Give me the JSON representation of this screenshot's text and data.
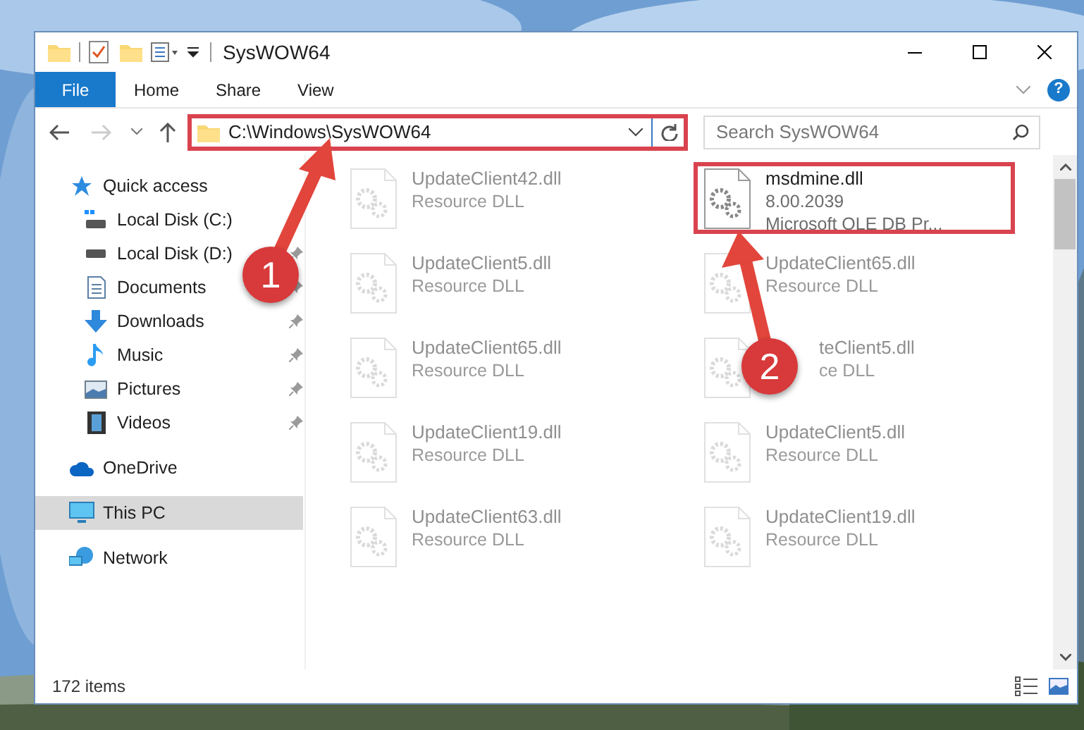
{
  "window": {
    "title": "SysWOW64"
  },
  "help_button": {
    "label": "?"
  },
  "ribbon_tabs": [
    {
      "label": "File",
      "selected": true
    },
    {
      "label": "Home",
      "selected": false
    },
    {
      "label": "Share",
      "selected": false
    },
    {
      "label": "View",
      "selected": false
    }
  ],
  "address": {
    "value": "C:\\Windows\\SysWOW64",
    "highlighted": true
  },
  "search": {
    "placeholder": "Search SysWOW64"
  },
  "sidebar": {
    "items": [
      {
        "label": "Quick access",
        "selected": false,
        "children": [
          {
            "label": "Local Disk (C:)",
            "selected": false,
            "pinned": false
          },
          {
            "label": "Local Disk (D:)",
            "selected": false,
            "pinned": true
          },
          {
            "label": "Documents",
            "selected": false,
            "pinned": true
          },
          {
            "label": "Downloads",
            "selected": false,
            "pinned": true
          },
          {
            "label": "Music",
            "selected": false,
            "pinned": true
          },
          {
            "label": "Pictures",
            "selected": false,
            "pinned": true
          },
          {
            "label": "Videos",
            "selected": false,
            "pinned": true
          }
        ]
      },
      {
        "label": "OneDrive",
        "selected": false
      },
      {
        "label": "This PC",
        "selected": true
      },
      {
        "label": "Network",
        "selected": false
      }
    ]
  },
  "files": [
    {
      "name": "UpdateClient42.dll",
      "details": [
        "Resource DLL"
      ],
      "highlighted": false
    },
    {
      "name": "msdmine.dll",
      "details": [
        "8.00.2039",
        "Microsoft OLE DB Pr..."
      ],
      "highlighted": true
    },
    {
      "name": "UpdateClient5.dll",
      "details": [
        "Resource DLL"
      ],
      "highlighted": false
    },
    {
      "name": "UpdateClient65.dll",
      "details": [
        "Resource DLL"
      ],
      "highlighted": false
    },
    {
      "name": "UpdateClient65.dll",
      "details": [
        "Resource DLL"
      ],
      "highlighted": false
    },
    {
      "name": "teClient5.dll",
      "details": [
        "ce DLL"
      ],
      "highlighted": false,
      "covered": true
    },
    {
      "name": "UpdateClient19.dll",
      "details": [
        "Resource DLL"
      ],
      "highlighted": false
    },
    {
      "name": "UpdateClient5.dll",
      "details": [
        "Resource DLL"
      ],
      "highlighted": false
    },
    {
      "name": "UpdateClient63.dll",
      "details": [
        "Resource DLL"
      ],
      "highlighted": false
    },
    {
      "name": "UpdateClient19.dll",
      "details": [
        "Resource DLL"
      ],
      "highlighted": false
    }
  ],
  "status_bar": {
    "count": "172 items"
  },
  "annotations": [
    {
      "label": "1"
    },
    {
      "label": "2"
    }
  ]
}
